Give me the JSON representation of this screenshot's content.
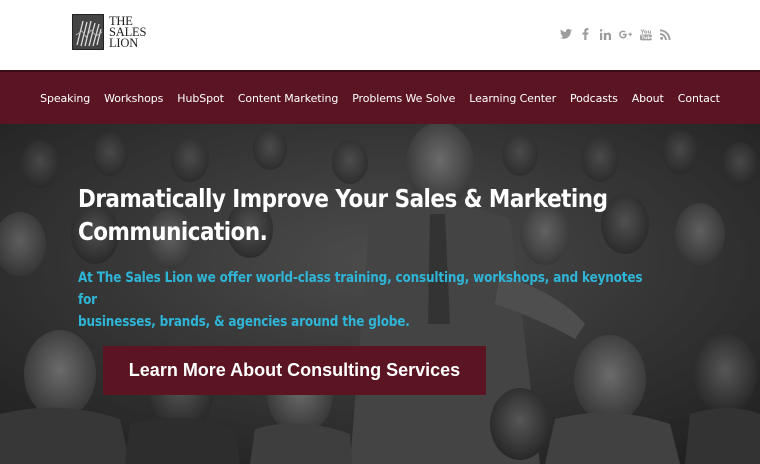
{
  "brand": {
    "logo_lines": [
      "THE",
      "SALES",
      "LION"
    ]
  },
  "social": {
    "icons": [
      "twitter-icon",
      "facebook-icon",
      "linkedin-icon",
      "google-plus-icon",
      "youtube-icon",
      "rss-icon"
    ],
    "color": "#9c9c9c"
  },
  "nav": {
    "items": [
      {
        "label": "Speaking"
      },
      {
        "label": "Workshops"
      },
      {
        "label": "HubSpot"
      },
      {
        "label": "Content Marketing"
      },
      {
        "label": "Problems We Solve"
      },
      {
        "label": "Learning Center"
      },
      {
        "label": "Podcasts"
      },
      {
        "label": "About"
      },
      {
        "label": "Contact"
      }
    ],
    "background": "#5b1522"
  },
  "hero": {
    "title_line1": "Dramatically Improve Your Sales & Marketing",
    "title_line2": "Communication.",
    "subtitle_line1": "At The Sales Lion we offer world-class training, consulting, workshops, and keynotes for",
    "subtitle_line2": "businesses, brands, & agencies around the globe.",
    "subtitle_color": "#2eb6d8",
    "cta_label": "Learn More About Consulting Services",
    "cta_color": "#5b1522"
  }
}
